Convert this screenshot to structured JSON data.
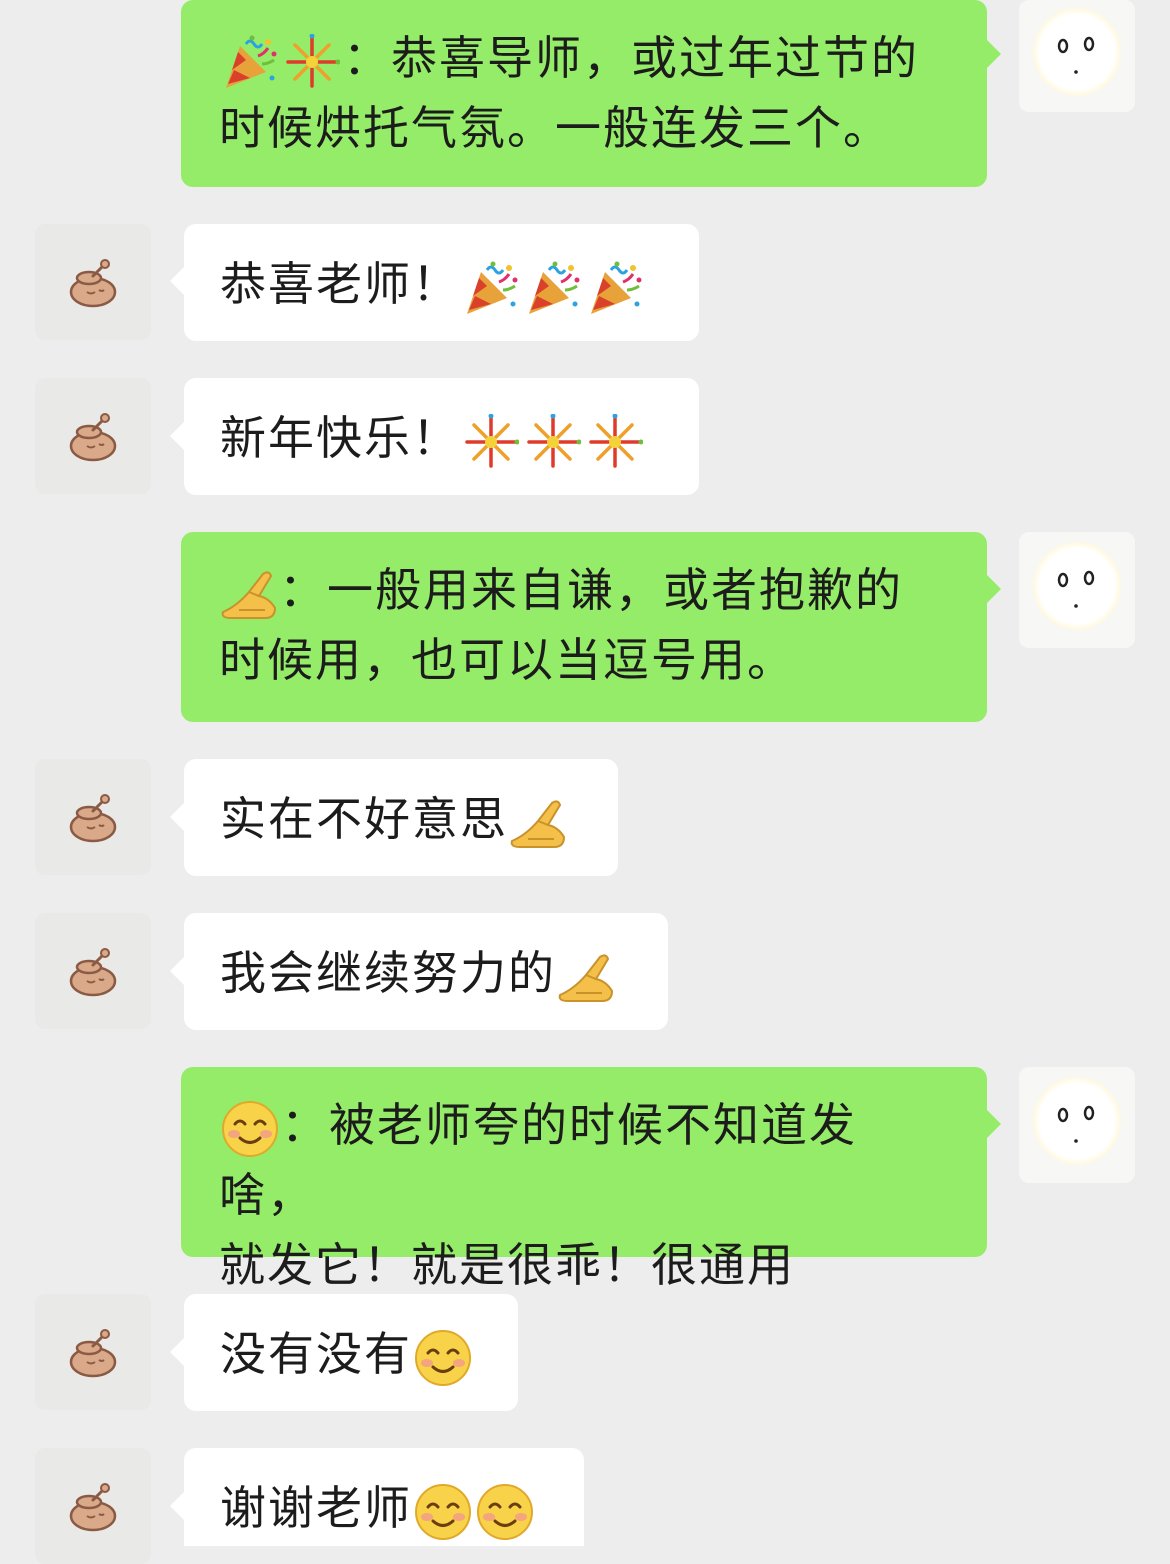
{
  "colors": {
    "background": "#ededed",
    "self_bubble": "#95ec69",
    "other_bubble": "#ffffff",
    "text": "#1c1c1c"
  },
  "messages": [
    {
      "side": "self",
      "emojis": [
        "party-popper-icon",
        "fireworks-icon"
      ],
      "line1": "：恭喜导师，或过年过节的",
      "line2": "时候烘托气氛。一般连发三个。"
    },
    {
      "side": "other",
      "text": "恭喜老师！",
      "emojis": [
        "party-popper-icon",
        "party-popper-icon",
        "party-popper-icon"
      ]
    },
    {
      "side": "other",
      "text": "新年快乐！",
      "emojis": [
        "fireworks-icon",
        "fireworks-icon",
        "fireworks-icon"
      ]
    },
    {
      "side": "self",
      "emojis": [
        "bow-hand-icon"
      ],
      "line1": "：一般用来自谦，或者抱歉的",
      "line2": "时候用，也可以当逗号用。"
    },
    {
      "side": "other",
      "text": "实在不好意思",
      "emojis": [
        "bow-hand-icon"
      ]
    },
    {
      "side": "other",
      "text": "我会继续努力的",
      "emojis": [
        "bow-hand-icon"
      ]
    },
    {
      "side": "self",
      "emojis": [
        "smile-icon"
      ],
      "line1": "：被老师夸的时候不知道发啥，",
      "line2": "就发它！就是很乖！很通用"
    },
    {
      "side": "other",
      "text": "没有没有",
      "emojis": [
        "smile-icon"
      ]
    },
    {
      "side": "other",
      "text": "谢谢老师",
      "emojis": [
        "smile-icon",
        "smile-icon"
      ]
    }
  ]
}
